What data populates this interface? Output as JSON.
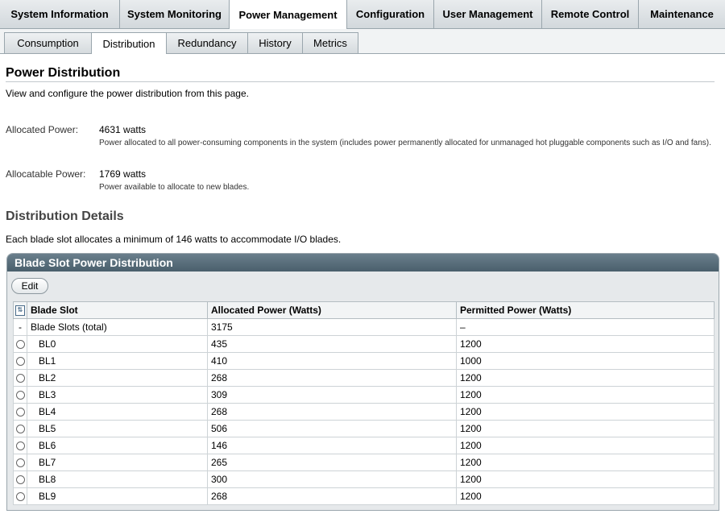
{
  "main_tabs": [
    {
      "label": "System Information"
    },
    {
      "label": "System Monitoring"
    },
    {
      "label": "Power Management"
    },
    {
      "label": "Configuration"
    },
    {
      "label": "User Management"
    },
    {
      "label": "Remote Control"
    },
    {
      "label": "Maintenance"
    }
  ],
  "sub_tabs": [
    {
      "label": "Consumption"
    },
    {
      "label": "Distribution"
    },
    {
      "label": "Redundancy"
    },
    {
      "label": "History"
    },
    {
      "label": "Metrics"
    }
  ],
  "page": {
    "title": "Power Distribution",
    "description": "View and configure the power distribution from this page."
  },
  "allocated": {
    "label": "Allocated Power:",
    "value": "4631 watts",
    "help": "Power allocated to all power-consuming components in the system (includes power permanently allocated for unmanaged hot pluggable components such as I/O and fans)."
  },
  "allocatable": {
    "label": "Allocatable Power:",
    "value": "1769 watts",
    "help": "Power available to allocate to new blades."
  },
  "details": {
    "title": "Distribution Details",
    "description": "Each blade slot allocates a minimum of 146 watts to accommodate I/O blades."
  },
  "table": {
    "title": "Blade Slot Power Distribution",
    "edit_label": "Edit",
    "select_icon": "select-all-icon",
    "columns": [
      "Blade Slot",
      "Allocated Power (Watts)",
      "Permitted Power (Watts)"
    ],
    "total_row": {
      "marker": "-",
      "slot": "Blade Slots (total)",
      "allocated": "3175",
      "permitted": "–"
    },
    "rows": [
      {
        "slot": "BL0",
        "allocated": "435",
        "permitted": "1200"
      },
      {
        "slot": "BL1",
        "allocated": "410",
        "permitted": "1000"
      },
      {
        "slot": "BL2",
        "allocated": "268",
        "permitted": "1200"
      },
      {
        "slot": "BL3",
        "allocated": "309",
        "permitted": "1200"
      },
      {
        "slot": "BL4",
        "allocated": "268",
        "permitted": "1200"
      },
      {
        "slot": "BL5",
        "allocated": "506",
        "permitted": "1200"
      },
      {
        "slot": "BL6",
        "allocated": "146",
        "permitted": "1200"
      },
      {
        "slot": "BL7",
        "allocated": "265",
        "permitted": "1200"
      },
      {
        "slot": "BL8",
        "allocated": "300",
        "permitted": "1200"
      },
      {
        "slot": "BL9",
        "allocated": "268",
        "permitted": "1200"
      }
    ]
  }
}
